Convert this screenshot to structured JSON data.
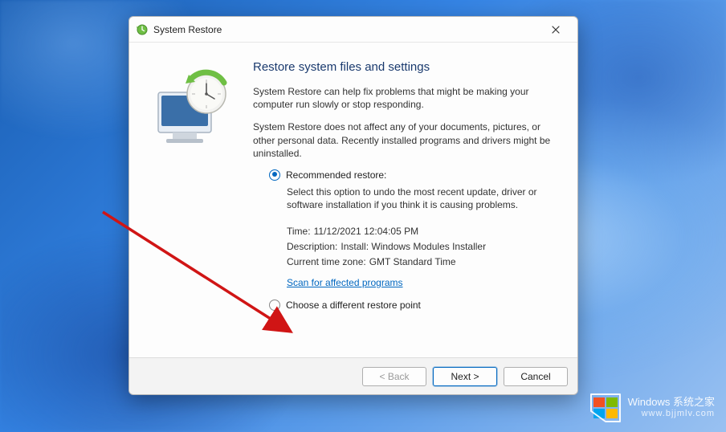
{
  "window": {
    "title": "System Restore"
  },
  "heading": "Restore system files and settings",
  "paragraph1": "System Restore can help fix problems that might be making your computer run slowly or stop responding.",
  "paragraph2": "System Restore does not affect any of your documents, pictures, or other personal data. Recently installed programs and drivers might be uninstalled.",
  "options": {
    "recommended": {
      "label": "Recommended restore:",
      "description": "Select this option to undo the most recent update, driver or software installation if you think it is causing problems."
    },
    "different": {
      "label": "Choose a different restore point"
    }
  },
  "details": {
    "time_label": "Time:",
    "time_value": "11/12/2021 12:04:05 PM",
    "description_label": "Description:",
    "description_value": "Install: Windows Modules Installer",
    "timezone_label": "Current time zone:",
    "timezone_value": "GMT Standard Time"
  },
  "scan_link": "Scan for affected programs",
  "buttons": {
    "back": "< Back",
    "next": "Next >",
    "cancel": "Cancel"
  },
  "watermark": {
    "line1": "Windows 系统之家",
    "line2": "www.bjjmlv.com"
  }
}
